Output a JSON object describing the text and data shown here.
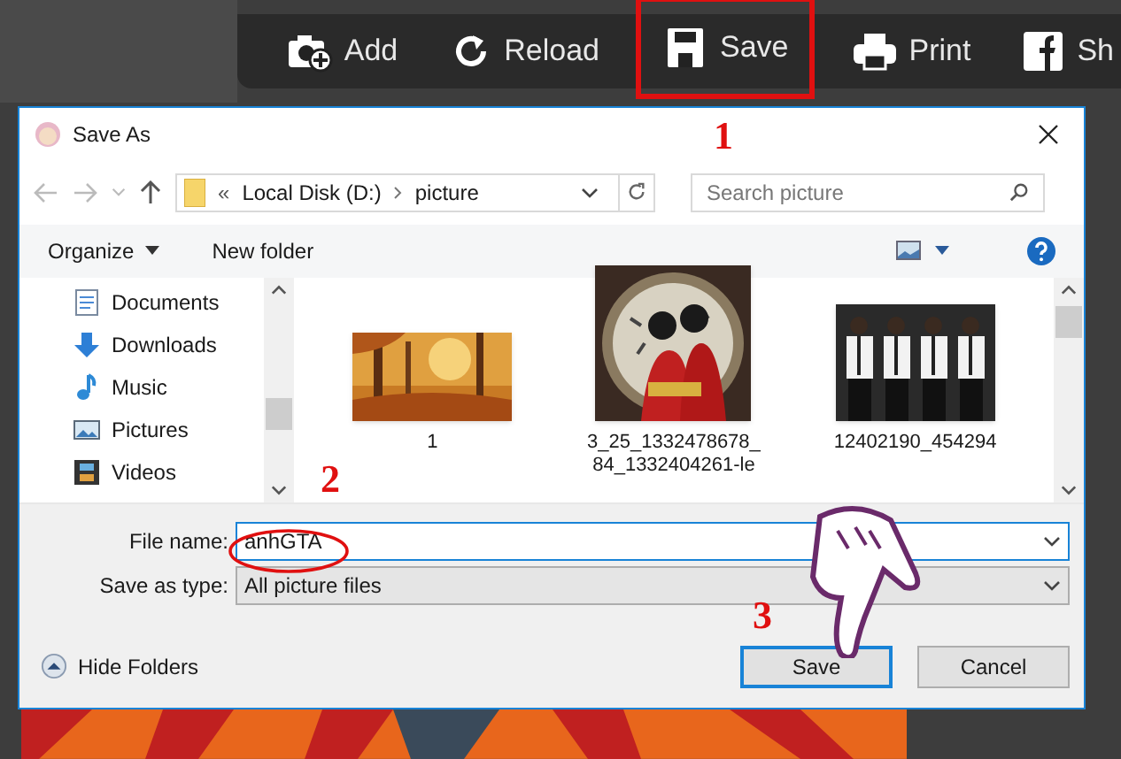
{
  "app_toolbar": {
    "buttons": [
      {
        "kind": "add",
        "label": "Add",
        "highlighted": false
      },
      {
        "kind": "reload",
        "label": "Reload",
        "highlighted": false
      },
      {
        "kind": "save",
        "label": "Save",
        "highlighted": true
      },
      {
        "kind": "print",
        "label": "Print",
        "highlighted": false
      },
      {
        "kind": "share",
        "label": "Sh",
        "highlighted": false
      }
    ]
  },
  "dialog": {
    "title": "Save As",
    "address": {
      "overflow": "«",
      "crumbs": [
        "Local Disk (D:)",
        "picture"
      ]
    },
    "search": {
      "placeholder": "Search picture"
    },
    "toolbar": {
      "organize": "Organize",
      "new_folder": "New folder"
    },
    "sidebar": {
      "items": [
        {
          "kind": "documents",
          "label": "Documents"
        },
        {
          "kind": "downloads",
          "label": "Downloads"
        },
        {
          "kind": "music",
          "label": "Music"
        },
        {
          "kind": "pictures",
          "label": "Pictures"
        },
        {
          "kind": "videos",
          "label": "Videos"
        }
      ]
    },
    "files": [
      {
        "kind": "forest",
        "label_lines": [
          "1"
        ]
      },
      {
        "kind": "mirror",
        "label_lines": [
          "3_25_1332478678_",
          "84_1332404261-le"
        ]
      },
      {
        "kind": "group",
        "label_lines": [
          "12402190_454294"
        ]
      }
    ],
    "file_name": {
      "label": "File name:",
      "value": "anhGTA"
    },
    "save_as_type": {
      "label": "Save as type:",
      "value": "All picture files"
    },
    "hide_folders": "Hide Folders",
    "buttons": [
      {
        "kind": "primary",
        "label": "Save"
      },
      {
        "kind": "secondary",
        "label": "Cancel"
      }
    ]
  },
  "annotations": {
    "step_1": "1",
    "step_2": "2",
    "step_3": "3"
  }
}
